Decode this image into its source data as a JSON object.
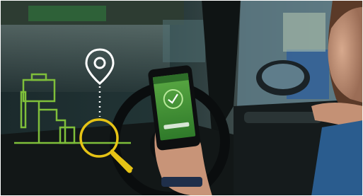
{
  "scene": {
    "description_hidden": "",
    "phone": {
      "screen_color": "#4f9a3c",
      "check_icon": "check-circle-icon"
    },
    "overlay": {
      "icons": [
        "map-pin-icon",
        "fuel-pump-icon",
        "magnifier-icon"
      ],
      "colors": {
        "pin": "#ffffff",
        "pump": "#7fbf3a",
        "magnifier": "#e6c315"
      }
    }
  }
}
